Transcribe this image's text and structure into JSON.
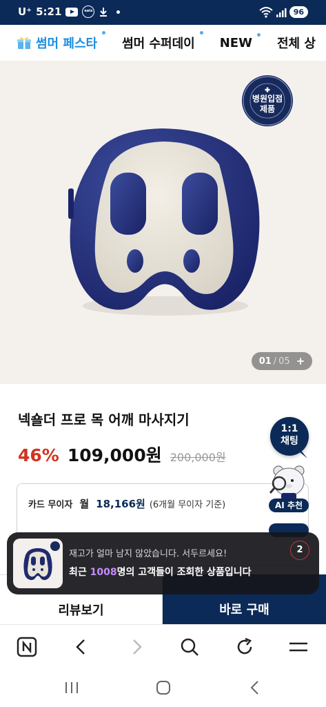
{
  "status_bar": {
    "carrier": "U⁺",
    "time": "5:21",
    "battery": "96",
    "eats_label": "coupang eats"
  },
  "nav_tabs": [
    {
      "label": "썸머 페스타",
      "dot": true
    },
    {
      "label": "썸머 수퍼데이",
      "dot": true
    },
    {
      "label": "NEW",
      "dot": true
    },
    {
      "label": "전체 상"
    }
  ],
  "hero": {
    "seal_text": "병원입점\n제품",
    "counter_current": "01",
    "counter_sep": "/",
    "counter_total": "05",
    "counter_plus": "+"
  },
  "product": {
    "title": "넥숄더 프로 목 어깨 마사지기",
    "discount": "46%",
    "price": "109,000원",
    "original_price": "200,000원"
  },
  "card_installment": {
    "label": "카드 무이자",
    "month_label": "월",
    "amount": "18,166원",
    "note": "(6개월 무이자 기준)"
  },
  "floating": {
    "chat_line1": "1:1",
    "chat_line2": "채팅",
    "ai_label": "AI 추천"
  },
  "toast": {
    "line1": "재고가 얼마 남지 않았습니다. 서두르세요!",
    "line2_prefix": "최근 ",
    "line2_count": "1008",
    "line2_suffix": "명의 고객들이 조회한 상품입니다",
    "badge": "2"
  },
  "actions": {
    "review_label": "리뷰보기",
    "buy_label": "바로 구매"
  },
  "browser_toolbar": [
    "home-icon",
    "back-icon",
    "forward-icon",
    "search-icon",
    "refresh-icon",
    "menu-icon"
  ],
  "system_nav": [
    "recent-apps-icon",
    "home-button-icon",
    "back-nav-icon"
  ],
  "colors": {
    "brand_navy": "#0b2a57",
    "discount_red": "#d2321f",
    "festa_blue": "#1a8de0",
    "highlight_purple": "#c58cff"
  }
}
